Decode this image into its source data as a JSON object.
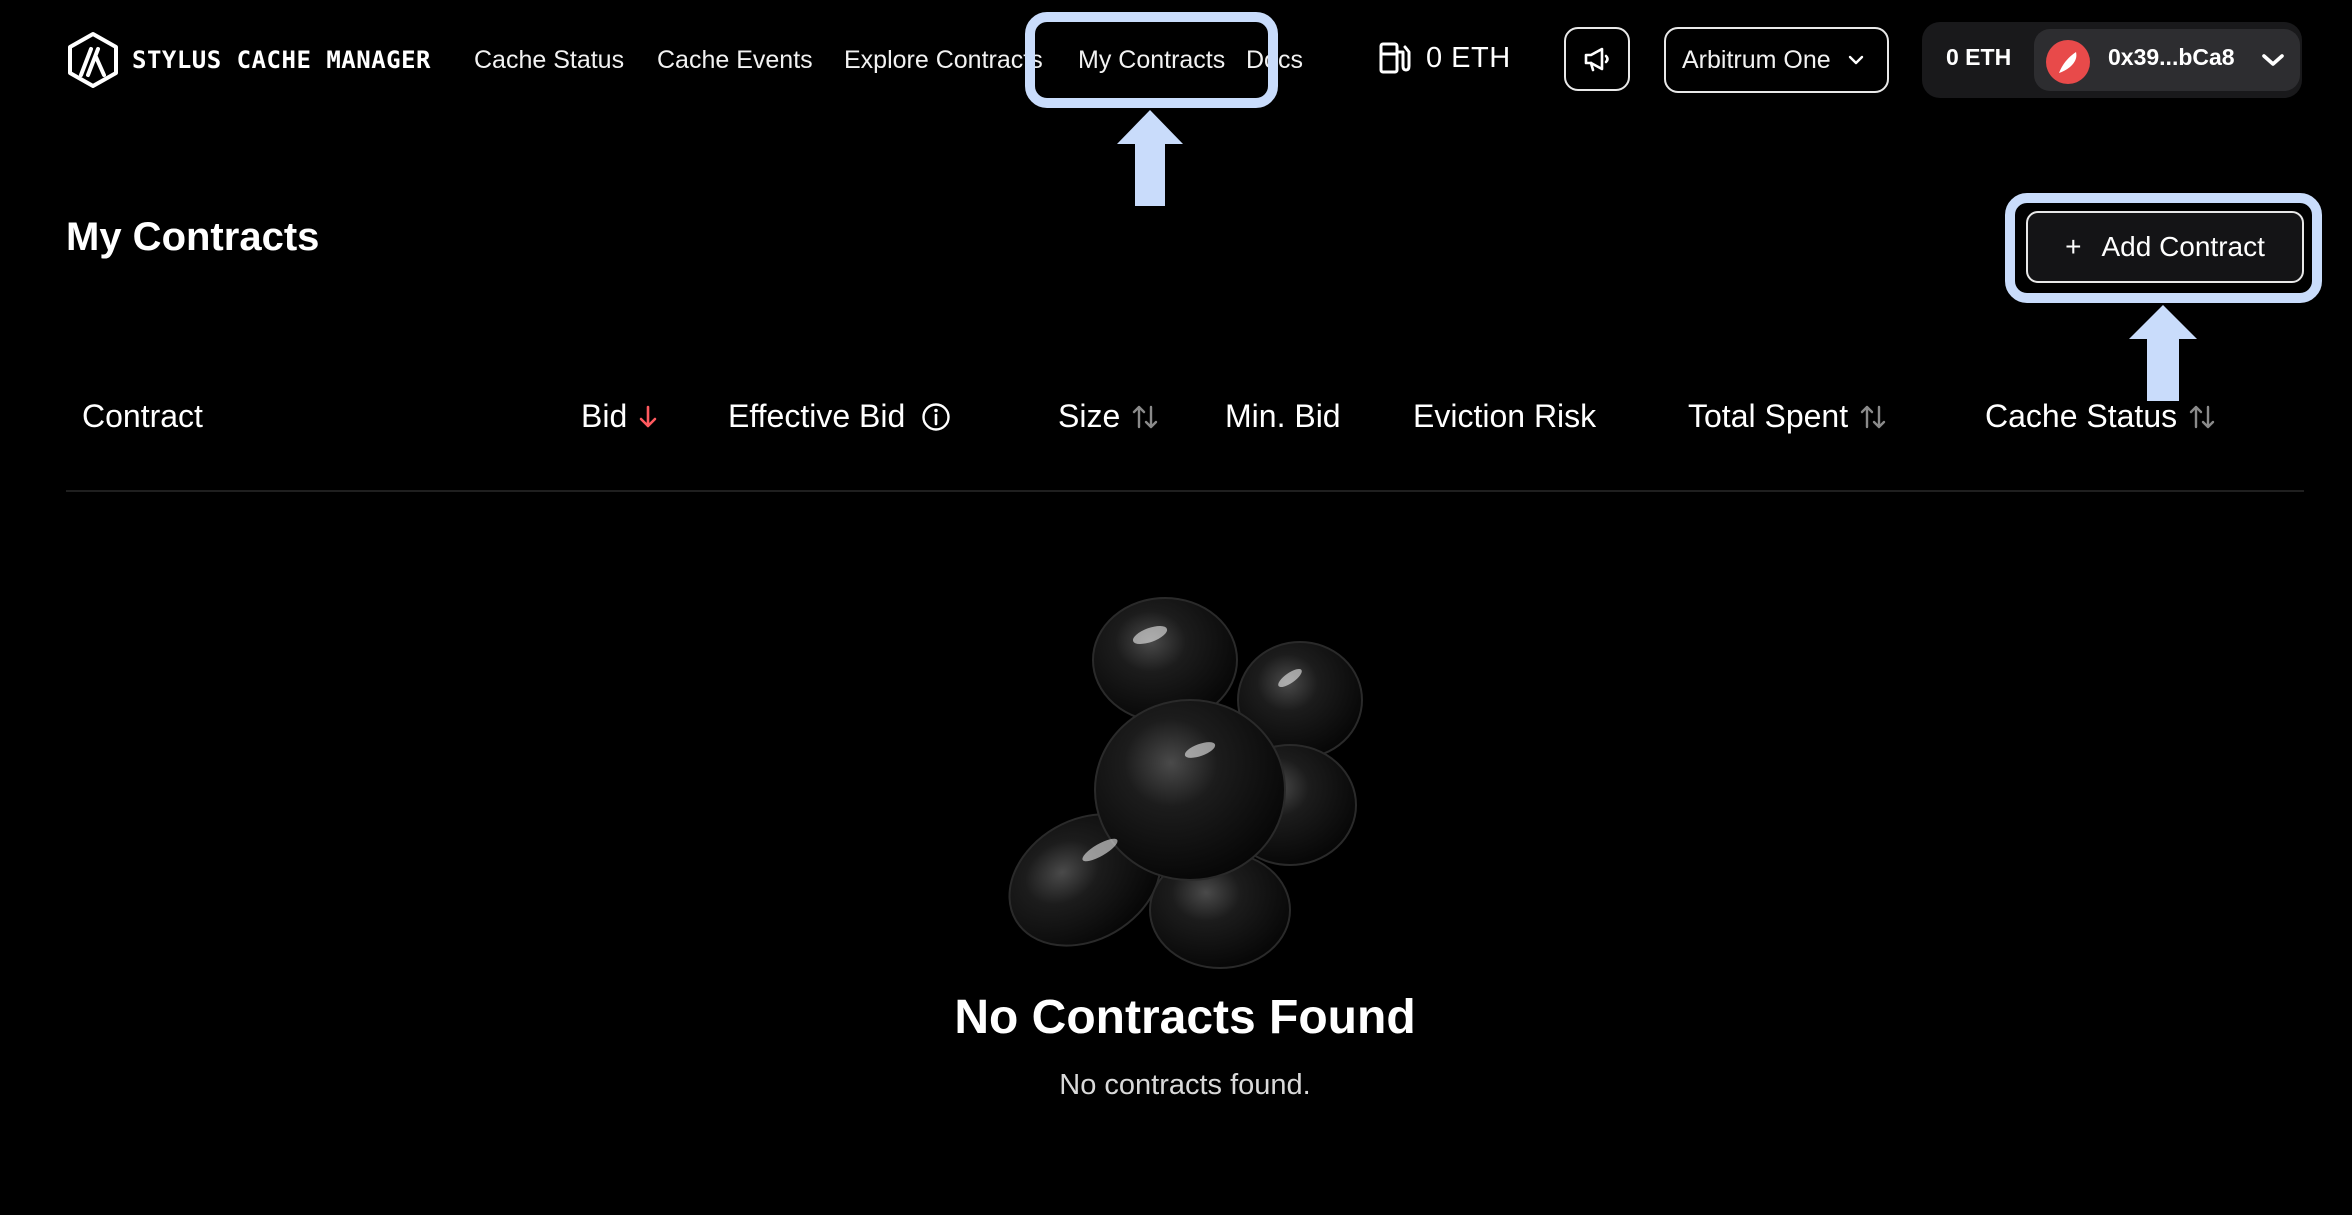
{
  "header": {
    "brand": "STYLUS CACHE MANAGER",
    "nav": [
      {
        "label": "Cache Status"
      },
      {
        "label": "Cache Events"
      },
      {
        "label": "Explore Contracts"
      },
      {
        "label": "My Contracts"
      },
      {
        "label": "Docs"
      }
    ],
    "gas_price": "0 ETH",
    "network": "Arbitrum One",
    "wallet": {
      "balance": "0 ETH",
      "address": "0x39...bCa8"
    }
  },
  "page": {
    "title": "My Contracts",
    "add_button": "Add Contract",
    "add_symbol": "+"
  },
  "table": {
    "columns": [
      {
        "label": "Contract",
        "sort": "none"
      },
      {
        "label": "Bid",
        "sort": "desc"
      },
      {
        "label": "Effective Bid",
        "sort": "info"
      },
      {
        "label": "Size",
        "sort": "both"
      },
      {
        "label": "Min. Bid",
        "sort": "none"
      },
      {
        "label": "Eviction Risk",
        "sort": "none"
      },
      {
        "label": "Total Spent",
        "sort": "both"
      },
      {
        "label": "Cache Status",
        "sort": "both"
      }
    ]
  },
  "empty_state": {
    "title": "No Contracts Found",
    "message": "No contracts found."
  },
  "colors": {
    "background": "#000000",
    "accent_sort_active": "#ff5a5f",
    "highlight": "#c9dcfb",
    "wallet_avatar": "#e84a4a"
  }
}
